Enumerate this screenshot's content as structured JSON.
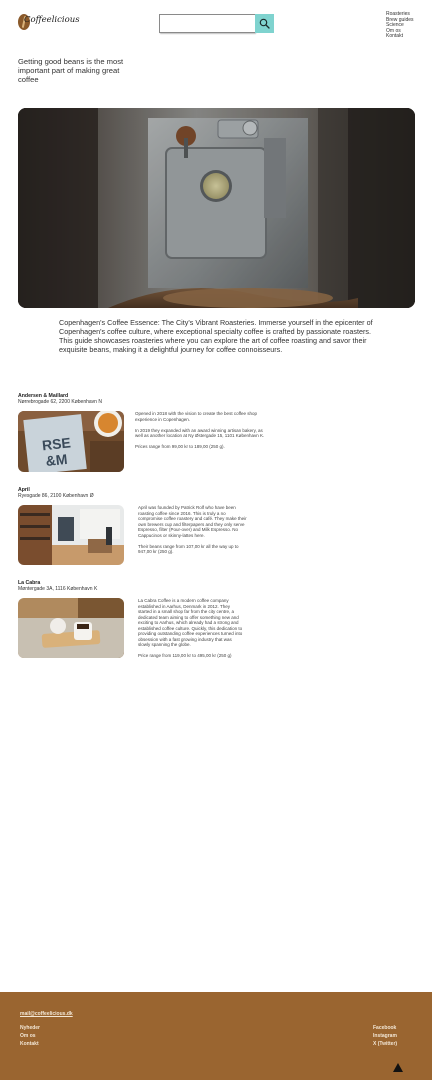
{
  "header": {
    "logo_text": "Coffeelicious",
    "search": {
      "placeholder": "",
      "value": ""
    },
    "nav": [
      "Roasteries",
      "Brew guides",
      "Science",
      "Om os",
      "Kontakt"
    ]
  },
  "tagline": "Getting good beans is the most important part of making great coffee",
  "intro": "Copenhagen's Coffee Essence: The City's Vibrant Roasteries. Immerse yourself in the epicenter of Copenhagen's coffee culture, where exceptional specialty coffee is crafted by passionate roasters. This guide showcases roasteries where you can explore the art of coffee roasting and savor their exquisite beans, making it a delightful journey for coffee connoisseurs.",
  "roasteries": [
    {
      "name": "Andersen & Maillard",
      "address": "Nørrebrogade 62, 2200 København N",
      "paragraphs": [
        "Opened in 2018 with the vision to create the best coffee shop experience in Copenhagen.",
        "In 2019 they expanded with an award winning artisan bakery, as well as another location at Ny Østergade 15, 1101 København K.",
        "Prices range from 99,00 kr to 189,00 (250 g)."
      ]
    },
    {
      "name": "April",
      "address": "Ryesgade 86, 2100 København Ø",
      "paragraphs": [
        "April was founded by Patrick Rolf who have been roasting coffee since 2016. This is truly a no compromise coffee roastery and café. They make their own brewers cup and filterpapers and they only serve Espresso, filter (Pour-over) and Milk Espresso. No Cappucinos or skinny-lattes here.",
        "Their beans range from 107,00 kr all the way up to 947,00 kr (250 g)."
      ]
    },
    {
      "name": "La Cabra",
      "address": "Møntergade 3A, 1116 København K",
      "paragraphs": [
        "La Cabra Coffee is a modern coffee company established in Aarhus, Denmark in 2012. They started in a small shop far from the city centre, a dedicated team aiming to offer something new and exciting to Aarhus, which already had a strong and established coffee culture. Quickly, this dedication to providing outstanding coffee experiences turned into obsession with a fast growing industry that was slowly spanning the globe.",
        "Price range from 119,00 kr to 495,00 kr (250 g)"
      ]
    }
  ],
  "footer": {
    "email": "mail@coffeelicious.dk",
    "left_links": [
      "Nyheder",
      "Om os",
      "Kontakt"
    ],
    "right_links": [
      "Facebook",
      "Instagram",
      "X (Twitter)"
    ]
  },
  "colors": {
    "accent": "#7fd3cf",
    "footer_bg": "#9a6530",
    "footer_text": "#f3e7d6"
  },
  "icons": [
    "search-icon",
    "scroll-to-top-icon"
  ]
}
